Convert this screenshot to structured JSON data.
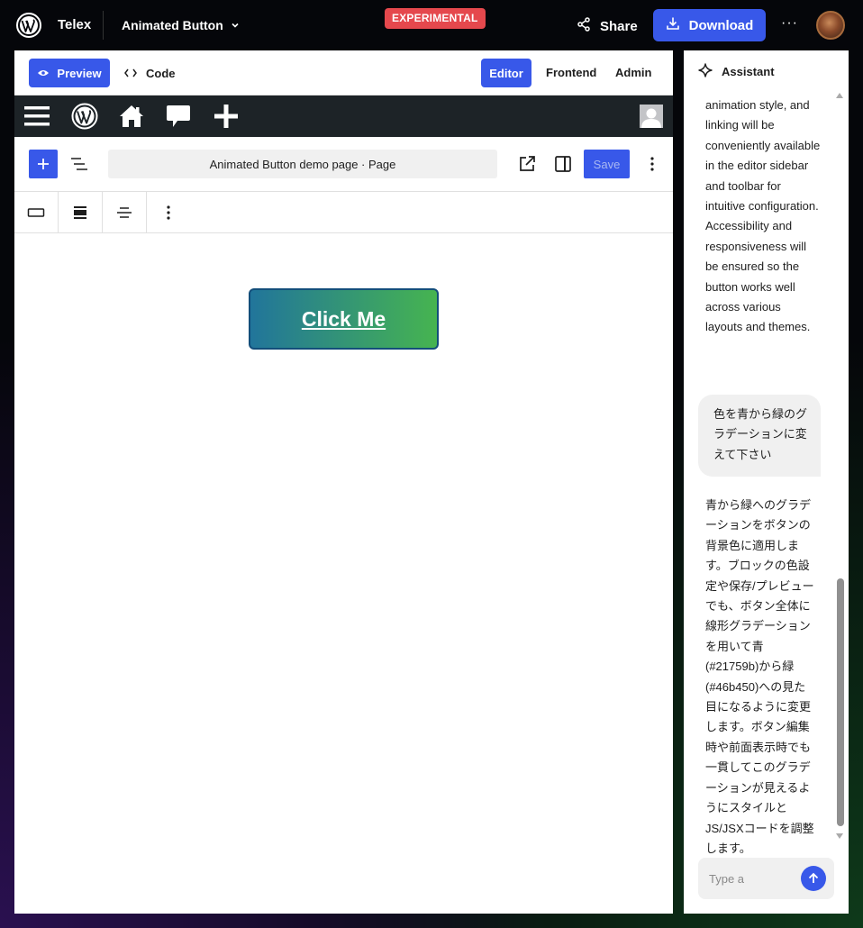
{
  "topbar": {
    "app_name": "Telex",
    "project_name": "Animated Button",
    "badge": "EXPERIMENTAL",
    "share_label": "Share",
    "download_label": "Download",
    "more_label": "···"
  },
  "preview_toolbar": {
    "preview_label": "Preview",
    "code_label": "Code",
    "editor_label": "Editor",
    "frontend_label": "Frontend",
    "admin_label": "Admin"
  },
  "editor": {
    "document_title": "Animated Button demo page · Page",
    "save_label": "Save"
  },
  "canvas": {
    "button_text": "Click Me",
    "gradient_start": "#21759b",
    "gradient_end": "#46b450"
  },
  "assistant": {
    "title": "Assistant",
    "message_top": "animation style, and linking will be conveniently available in the editor sidebar and toolbar for intuitive configuration. Accessibility and responsiveness will be ensured so the button works well across various layouts and themes.",
    "user_message": "色を青から緑のグラデーションに変えて下さい",
    "reply": "青から緑へのグラデーションをボタンの背景色に適用します。ブロックの色設定や保存/プレビューでも、ボタン全体に線形グラデーションを用いて青(#21759b)から緑(#46b450)への見た目になるように変更します。ボタン編集時や前面表示時でも一貫してこのグラデーションが見えるようにスタイルとJS/JSXコードを調整します。",
    "input_placeholder": "Type a"
  },
  "colors": {
    "accent": "#3858e9",
    "badge": "#e5484d",
    "admin_bar": "#1d2327"
  }
}
